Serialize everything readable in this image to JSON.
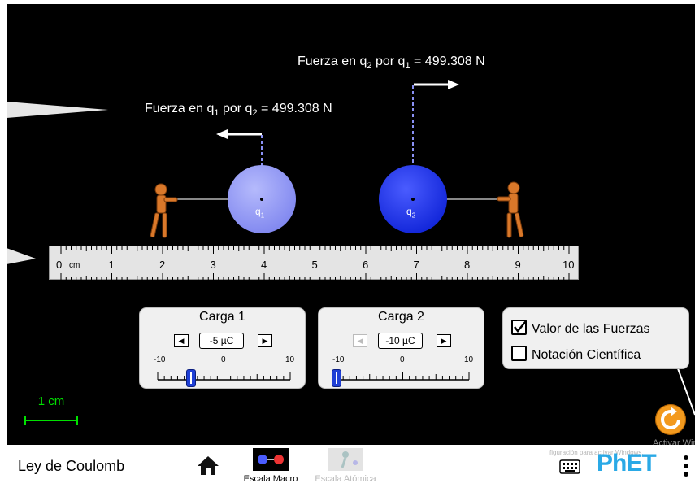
{
  "forces": {
    "q1_label_prefix": "Fuerza en q",
    "q1_sub_a": "1",
    "q1_mid": " por q",
    "q1_sub_b": "2",
    "q1_value": " = 499.308 N",
    "q2_label_prefix": "Fuerza en q",
    "q2_sub_a": "2",
    "q2_mid": " por q",
    "q2_sub_b": "1",
    "q2_value": " = 499.308 N"
  },
  "charges": {
    "q1_label": "q",
    "q1_sub": "1",
    "q2_label": "q",
    "q2_sub": "2",
    "q1_color": "#8a91f5",
    "q2_color": "#1b2ff0"
  },
  "ruler": {
    "unit": "cm",
    "labels": [
      "0",
      "1",
      "2",
      "3",
      "4",
      "5",
      "6",
      "7",
      "8",
      "9",
      "10"
    ]
  },
  "charge1": {
    "title": "Carga 1",
    "value": "-5 µC",
    "min": "-10",
    "mid": "0",
    "max": "10",
    "level": -5
  },
  "charge2": {
    "title": "Carga 2",
    "value": "-10 µC",
    "min": "-10",
    "mid": "0",
    "max": "10",
    "level": -10
  },
  "options": {
    "force_values": {
      "label": "Valor de las Fuerzas",
      "checked": true
    },
    "sci_notation": {
      "label": "Notación Científica",
      "checked": false
    }
  },
  "scale": {
    "label": "1 cm"
  },
  "watermark": {
    "line1": "Activar Windo",
    "line2": "figuración para activar Windows."
  },
  "navbar": {
    "title": "Ley de Coulomb",
    "screens": [
      {
        "label": "Escala Macro",
        "active": true
      },
      {
        "label": "Escala Atómica",
        "active": false
      }
    ],
    "brand": "PhET"
  },
  "colors": {
    "accent_green": "#00e000",
    "reset_orange": "#f39a1e",
    "phet_blue": "#2aa9e6"
  }
}
